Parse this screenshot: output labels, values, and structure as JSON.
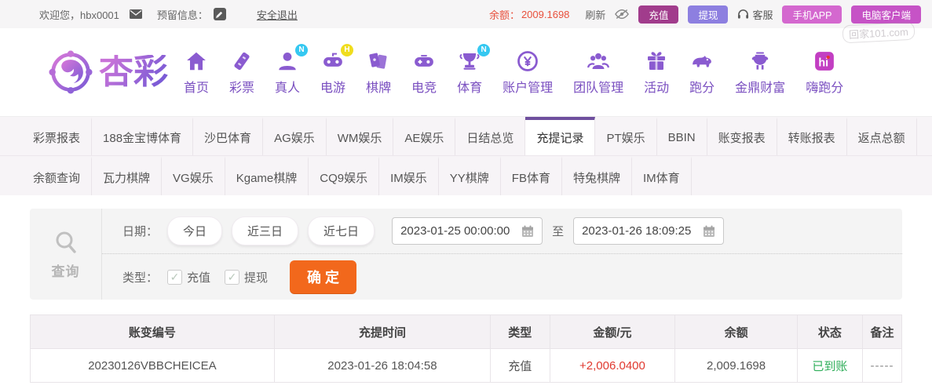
{
  "topbar": {
    "welcome": "欢迎您，hbx0001",
    "envelope_icon": "envelope-icon",
    "reserved_label": "预留信息：",
    "edit_icon": "edit-icon",
    "logout_link": "安全退出",
    "balance_label": "余额：",
    "balance_value": "2009.1698",
    "refresh_label": "刷新",
    "eye_icon": "eye-off-icon",
    "deposit_button": "充值",
    "withdraw_button": "提现",
    "headset_icon": "headset-icon",
    "service_label": "客服",
    "mobile_app_button": "手机APP",
    "pc_client_button": "电脑客户端"
  },
  "watermark": "回家101.com",
  "brand": {
    "logo_text": "杏彩",
    "logo_icon": "brand-flower-icon"
  },
  "nav": {
    "items": [
      {
        "label": "首页",
        "icon": "home-icon",
        "badge": ""
      },
      {
        "label": "彩票",
        "icon": "lottery-ticket-icon",
        "badge": ""
      },
      {
        "label": "真人",
        "icon": "live-person-icon",
        "badge": "N",
        "badge_color": "#35c8f1"
      },
      {
        "label": "电游",
        "icon": "egame-gamepad-icon",
        "badge": "H",
        "badge_color": "#f0dd1e"
      },
      {
        "label": "棋牌",
        "icon": "chess-cards-icon",
        "badge": ""
      },
      {
        "label": "电竞",
        "icon": "esports-gamepad-icon",
        "badge": ""
      },
      {
        "label": "体育",
        "icon": "sports-trophy-icon",
        "badge": "N",
        "badge_color": "#35c8f1"
      },
      {
        "label": "账户管理",
        "icon": "account-coin-icon",
        "badge": ""
      },
      {
        "label": "团队管理",
        "icon": "team-people-icon",
        "badge": ""
      },
      {
        "label": "活动",
        "icon": "activity-gift-icon",
        "badge": ""
      },
      {
        "label": "跑分",
        "icon": "paofen-rhino-icon",
        "badge": ""
      },
      {
        "label": "金鼎财富",
        "icon": "jinding-wealth-icon",
        "badge": ""
      },
      {
        "label": "嗨跑分",
        "icon": "hi-paofen-icon",
        "badge": ""
      }
    ]
  },
  "tabs": {
    "row1": [
      {
        "label": "彩票报表"
      },
      {
        "label": "188金宝博体育"
      },
      {
        "label": "沙巴体育"
      },
      {
        "label": "AG娱乐"
      },
      {
        "label": "WM娱乐"
      },
      {
        "label": "AE娱乐"
      },
      {
        "label": "日结总览"
      },
      {
        "label": "充提记录",
        "active": true
      },
      {
        "label": "PT娱乐"
      },
      {
        "label": "BBIN"
      },
      {
        "label": "账变报表"
      },
      {
        "label": "转账报表"
      },
      {
        "label": "返点总额"
      }
    ],
    "row2": [
      {
        "label": "余额查询"
      },
      {
        "label": "瓦力棋牌"
      },
      {
        "label": "VG娱乐"
      },
      {
        "label": "Kgame棋牌"
      },
      {
        "label": "CQ9娱乐"
      },
      {
        "label": "IM娱乐"
      },
      {
        "label": "YY棋牌"
      },
      {
        "label": "FB体育"
      },
      {
        "label": "特兔棋牌"
      },
      {
        "label": "IM体育"
      }
    ]
  },
  "filter": {
    "search_icon": "search-icon",
    "query_label": "查询",
    "date_label": "日期：",
    "quick_ranges": [
      "今日",
      "近三日",
      "近七日"
    ],
    "date_from": "2023-01-25 00:00:00",
    "calendar_icon": "calendar-icon",
    "to_label": "至",
    "date_to": "2023-01-26 18:09:25",
    "type_label": "类型：",
    "type_options": [
      {
        "label": "充值",
        "checked": true
      },
      {
        "label": "提现",
        "checked": true
      }
    ],
    "confirm_button": "确 定"
  },
  "table": {
    "headers": [
      "账变编号",
      "充提时间",
      "类型",
      "金额/元",
      "余额",
      "状态",
      "备注"
    ],
    "rows": [
      {
        "id": "20230126VBBCHEICEA",
        "time": "2023-01-26 18:04:58",
        "type": "充值",
        "amount": "+2,006.0400",
        "balance": "2,009.1698",
        "status": "已到账",
        "remark": "-----"
      }
    ]
  },
  "colors": {
    "accent_purple": "#7a4fc0",
    "active_tab_border": "#6f4f9e",
    "deposit_button": "#a13c8c",
    "withdraw_button": "#8d7fe0",
    "mobile_app_button": "#d468cf",
    "pc_client_button": "#c653c6",
    "balance_text": "#e8503c",
    "amount_positive": "#e0392f",
    "status_success": "#2fae5a",
    "confirm_orange": "#f2681c"
  }
}
